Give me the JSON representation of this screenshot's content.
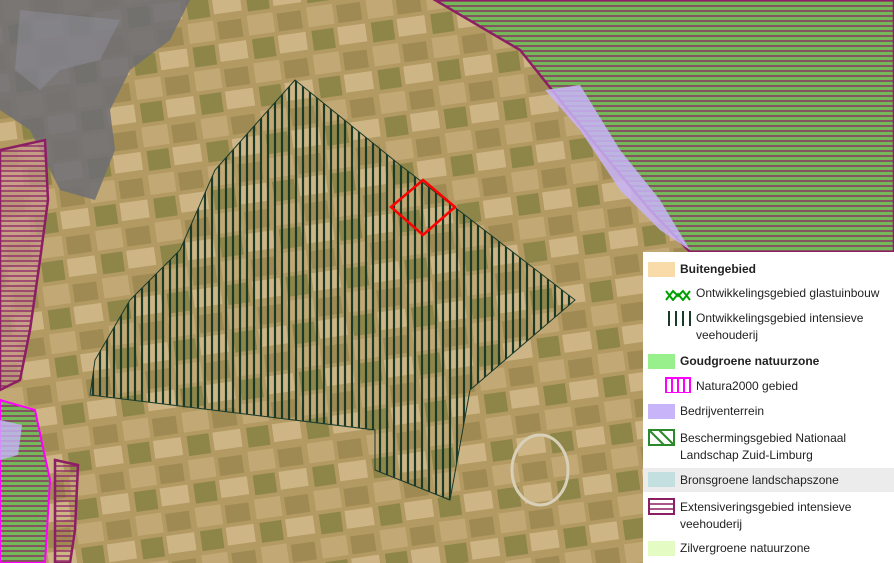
{
  "legend": {
    "items": [
      {
        "label": "Buitengebied",
        "bold": true,
        "swatch": "#f8dba8"
      },
      {
        "label": "Ontwikkelingsgebied glastuinbouw",
        "swatch_icon": "green-cross-hatch-icon",
        "color": "#00a000"
      },
      {
        "label_lines": [
          "Ontwikkelingsgebied intensieve",
          "veehouderij"
        ],
        "swatch_icon": "vertical-lines-icon",
        "color": "#1a3a2a"
      },
      {
        "label": "Goudgroene natuurzone",
        "bold": true,
        "swatch": "#98f08c"
      },
      {
        "label": "Natura2000 gebied",
        "swatch_icon": "magenta-vertical-lines-icon",
        "color": "#ff00ff"
      },
      {
        "label": "Bedrijventerrein",
        "swatch": "#c8b4f8"
      },
      {
        "label_lines": [
          "Beschermingsgebied Nationaal",
          "Landschap Zuid-Limburg"
        ],
        "swatch_icon": "green-diagonal-lines-icon",
        "color": "#2a8a2a"
      },
      {
        "label": "Bronsgroene landschapszone",
        "swatch": "#c4dfe0",
        "highlighted": true
      },
      {
        "label_lines": [
          "Extensiveringsgebied intensieve",
          "veehouderij"
        ],
        "swatch_icon": "purple-horizontal-lines-icon",
        "color": "#8c1f64"
      },
      {
        "label": "Zilvergroene natuurzone",
        "swatch": "#e4fcc4"
      }
    ]
  },
  "map": {
    "colors": {
      "farmland": "#b39a62",
      "nature_green": "#74b85a",
      "natura2000": "#ff00ff",
      "extensivering": "#8c1f64",
      "intensive_lines": "#1a3a2a",
      "selection_marker": "#ff0000",
      "bedrijventerrein": "#c8b4f8"
    }
  }
}
